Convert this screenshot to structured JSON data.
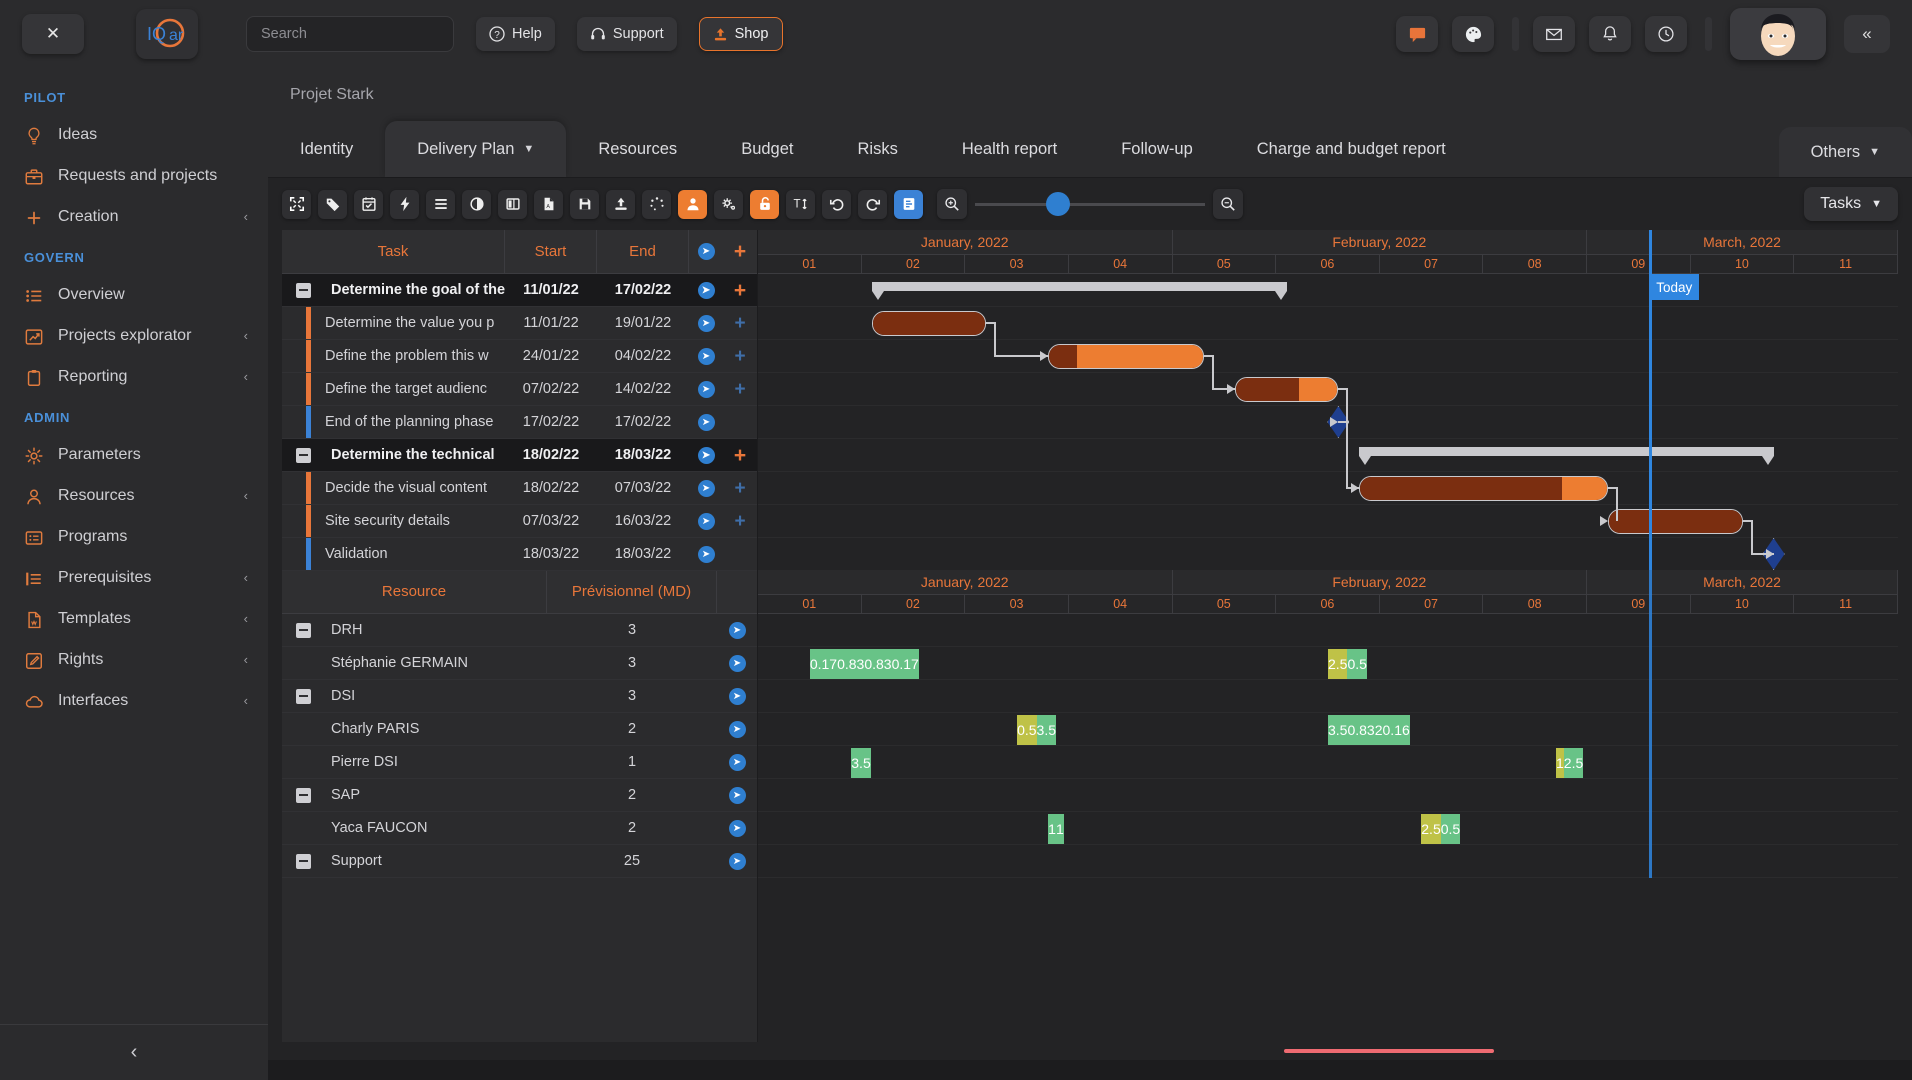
{
  "topbar": {
    "close_label": "✕",
    "logo_text": "IQar",
    "search_placeholder": "Search",
    "help_label": "Help",
    "support_label": "Support",
    "shop_label": "Shop",
    "icons": [
      "chat-icon",
      "palette-icon",
      "mail-icon",
      "bell-icon",
      "clock-icon"
    ],
    "collapse_label": "«"
  },
  "sidebar": {
    "sections": [
      {
        "title": "PILOT",
        "items": [
          {
            "label": "Ideas",
            "icon": "lightbulb-icon",
            "caret": false
          },
          {
            "label": "Requests and projects",
            "icon": "briefcase-icon",
            "caret": false
          },
          {
            "label": "Creation",
            "icon": "plus-icon",
            "caret": true
          }
        ]
      },
      {
        "title": "GOVERN",
        "items": [
          {
            "label": "Overview",
            "icon": "list-icon",
            "caret": false
          },
          {
            "label": "Projects explorator",
            "icon": "export-chart-icon",
            "caret": true
          },
          {
            "label": "Reporting",
            "icon": "clipboard-icon",
            "caret": true
          }
        ]
      },
      {
        "title": "ADMIN",
        "items": [
          {
            "label": "Parameters",
            "icon": "gear-icon",
            "caret": false
          },
          {
            "label": "Resources",
            "icon": "user-icon",
            "caret": true
          },
          {
            "label": "Programs",
            "icon": "grid-card-icon",
            "caret": false
          },
          {
            "label": "Prerequisites",
            "icon": "indent-list-icon",
            "caret": true
          },
          {
            "label": "Templates",
            "icon": "document-icon",
            "caret": true
          },
          {
            "label": "Rights",
            "icon": "edit-square-icon",
            "caret": true
          },
          {
            "label": "Interfaces",
            "icon": "cloud-icon",
            "caret": true
          }
        ]
      }
    ],
    "collapse_label": "‹"
  },
  "breadcrumb": {
    "text": "Projet Stark"
  },
  "tabs": {
    "items": [
      {
        "label": "Identity",
        "active": false,
        "caret": false
      },
      {
        "label": "Delivery Plan",
        "active": true,
        "caret": true
      },
      {
        "label": "Resources",
        "active": false,
        "caret": false
      },
      {
        "label": "Budget",
        "active": false,
        "caret": false
      },
      {
        "label": "Risks",
        "active": false,
        "caret": false
      },
      {
        "label": "Health report",
        "active": false,
        "caret": false
      },
      {
        "label": "Follow-up",
        "active": false,
        "caret": false
      },
      {
        "label": "Charge and budget report",
        "active": false,
        "caret": false
      }
    ],
    "others": {
      "label": "Others",
      "caret": true
    }
  },
  "toolbar": {
    "buttons": [
      {
        "name": "fit-screen-icon",
        "state": "normal"
      },
      {
        "name": "tag-icon",
        "state": "normal"
      },
      {
        "name": "calendar-check-icon",
        "state": "normal"
      },
      {
        "name": "lightning-icon",
        "state": "normal"
      },
      {
        "name": "menu-lines-icon",
        "state": "normal"
      },
      {
        "name": "contrast-circle-icon",
        "state": "normal"
      },
      {
        "name": "columns-icon",
        "state": "normal"
      },
      {
        "name": "pdf-file-icon",
        "state": "normal"
      },
      {
        "name": "save-disk-icon",
        "state": "normal"
      },
      {
        "name": "upload-icon",
        "state": "normal"
      },
      {
        "name": "spinner-dots-icon",
        "state": "normal"
      },
      {
        "name": "person-icon",
        "state": "orange"
      },
      {
        "name": "gears-icon",
        "state": "normal"
      },
      {
        "name": "unlock-icon",
        "state": "orange"
      },
      {
        "name": "text-height-icon",
        "state": "normal"
      },
      {
        "name": "undo-icon",
        "state": "normal"
      },
      {
        "name": "redo-icon",
        "state": "normal"
      },
      {
        "name": "report-icon",
        "state": "blue"
      }
    ],
    "zoom_in_icon": "zoom-in-icon",
    "zoom_out_icon": "zoom-out-icon",
    "zoom_value": 36,
    "tasks_dropdown": "Tasks"
  },
  "task_table": {
    "headers": {
      "task": "Task",
      "start": "Start",
      "end": "End"
    },
    "rows": [
      {
        "type": "summary",
        "name": "Determine the goal of the",
        "start": "11/01/22",
        "end": "17/02/22",
        "has_plus": true
      },
      {
        "type": "task",
        "marker": "orange",
        "name": "Determine the value you p",
        "start": "11/01/22",
        "end": "19/01/22",
        "has_plus": true,
        "plus_dim": true
      },
      {
        "type": "task",
        "marker": "orange",
        "name": "Define the problem this w",
        "start": "24/01/22",
        "end": "04/02/22",
        "has_plus": true,
        "plus_dim": true
      },
      {
        "type": "task",
        "marker": "orange",
        "name": "Define the target audienc",
        "start": "07/02/22",
        "end": "14/02/22",
        "has_plus": true,
        "plus_dim": true
      },
      {
        "type": "task",
        "marker": "blue",
        "name": "End of the planning phase",
        "start": "17/02/22",
        "end": "17/02/22",
        "has_plus": false
      },
      {
        "type": "summary",
        "name": "Determine the technical",
        "start": "18/02/22",
        "end": "18/03/22",
        "has_plus": true
      },
      {
        "type": "task",
        "marker": "orange",
        "name": "Decide the visual content",
        "start": "18/02/22",
        "end": "07/03/22",
        "has_plus": true,
        "plus_dim": true
      },
      {
        "type": "task",
        "marker": "orange",
        "name": "Site security details",
        "start": "07/03/22",
        "end": "16/03/22",
        "has_plus": true,
        "plus_dim": true
      },
      {
        "type": "task",
        "marker": "blue",
        "name": "Validation",
        "start": "18/03/22",
        "end": "18/03/22",
        "has_plus": false
      }
    ]
  },
  "resource_table": {
    "headers": {
      "resource": "Resource",
      "planned": "Prévisionnel (MD)"
    },
    "rows": [
      {
        "type": "group",
        "name": "DRH",
        "value": "3"
      },
      {
        "type": "member",
        "name": "Stéphanie GERMAIN",
        "value": "3"
      },
      {
        "type": "group",
        "name": "DSI",
        "value": "3"
      },
      {
        "type": "member",
        "name": "Charly PARIS",
        "value": "2"
      },
      {
        "type": "member",
        "name": "Pierre DSI",
        "value": "1"
      },
      {
        "type": "group",
        "name": "SAP",
        "value": "2"
      },
      {
        "type": "member",
        "name": "Yaca FAUCON",
        "value": "2"
      },
      {
        "type": "group",
        "name": "Support",
        "value": "25"
      }
    ]
  },
  "timeline": {
    "months": [
      {
        "label": "January, 2022",
        "weeks": 4
      },
      {
        "label": "February, 2022",
        "weeks": 4
      },
      {
        "label": "March, 2022",
        "weeks": 3
      }
    ],
    "weeks": [
      "01",
      "02",
      "03",
      "04",
      "05",
      "06",
      "07",
      "08",
      "09",
      "10",
      "11"
    ],
    "today_label": "Today"
  },
  "chart_data": {
    "type": "gantt",
    "title": "Delivery Plan — Projet Stark",
    "time_axis": {
      "unit": "week",
      "ticks": [
        "01",
        "02",
        "03",
        "04",
        "05",
        "06",
        "07",
        "08",
        "09",
        "10",
        "11"
      ],
      "months": [
        "January, 2022",
        "February, 2022",
        "March, 2022"
      ],
      "today_marker_week": 8.6
    },
    "tasks": [
      {
        "name": "Determine the goal of the",
        "start": "11/01/22",
        "end": "17/02/22",
        "kind": "summary",
        "start_week": 1.1,
        "end_week": 5.1
      },
      {
        "name": "Determine the value you p",
        "start": "11/01/22",
        "end": "19/01/22",
        "kind": "task",
        "progress_pct": 100,
        "start_week": 1.1,
        "end_week": 2.2
      },
      {
        "name": "Define the problem this w",
        "start": "24/01/22",
        "end": "04/02/22",
        "kind": "task",
        "progress_pct": 18,
        "start_week": 2.8,
        "end_week": 4.3
      },
      {
        "name": "Define the target audienc",
        "start": "07/02/22",
        "end": "14/02/22",
        "kind": "task",
        "progress_pct": 62,
        "start_week": 4.6,
        "end_week": 5.6
      },
      {
        "name": "End of the planning phase",
        "start": "17/02/22",
        "end": "17/02/22",
        "kind": "milestone",
        "start_week": 5.6,
        "end_week": 5.6
      },
      {
        "name": "Determine the technical",
        "start": "18/02/22",
        "end": "18/03/22",
        "kind": "summary",
        "start_week": 5.8,
        "end_week": 9.8
      },
      {
        "name": "Decide the visual content",
        "start": "18/02/22",
        "end": "07/03/22",
        "kind": "task",
        "progress_pct": 82,
        "start_week": 5.8,
        "end_week": 8.2
      },
      {
        "name": "Site security details",
        "start": "07/03/22",
        "end": "16/03/22",
        "kind": "task",
        "progress_pct": 100,
        "start_week": 8.2,
        "end_week": 9.5
      },
      {
        "name": "Validation",
        "start": "18/03/22",
        "end": "18/03/22",
        "kind": "milestone",
        "start_week": 9.8,
        "end_week": 9.8
      }
    ],
    "resource_histogram": {
      "unit": "MD",
      "green_color": "#68c387",
      "olive_color": "#bfc247",
      "rows": [
        {
          "resource": "DRH",
          "segments": []
        },
        {
          "resource": "Stéphanie GERMAIN",
          "segments": [
            {
              "value": "0.17",
              "level": "green",
              "start_week": 0.5,
              "weeks": 1
            },
            {
              "value": "0.83",
              "level": "green",
              "start_week": 1.5,
              "weeks": 1
            },
            {
              "value": "0.83",
              "level": "green",
              "start_week": 2.5,
              "weeks": 1
            },
            {
              "value": "0.17",
              "level": "green",
              "start_week": 3.5,
              "weeks": 1
            },
            {
              "value": "2.5",
              "level": "olive",
              "start_week": 5.5,
              "weeks": 1
            },
            {
              "value": "0.5",
              "level": "green",
              "start_week": 6.5,
              "weeks": 1
            }
          ]
        },
        {
          "resource": "DSI",
          "segments": []
        },
        {
          "resource": "Charly PARIS",
          "segments": [
            {
              "value": "0.5",
              "level": "olive",
              "start_week": 2.5,
              "weeks": 1
            },
            {
              "value": "3.5",
              "level": "green",
              "start_week": 3.5,
              "weeks": 1
            },
            {
              "value": "3.5",
              "level": "green",
              "start_week": 5.5,
              "weeks": 1
            },
            {
              "value": "0.83",
              "level": "green",
              "start_week": 6.5,
              "weeks": 1
            },
            {
              "value": "2",
              "level": "green",
              "start_week": 7.5,
              "weeks": 1
            },
            {
              "value": "0.16",
              "level": "green",
              "start_week": 8.5,
              "weeks": 1
            }
          ]
        },
        {
          "resource": "Pierre DSI",
          "segments": [
            {
              "value": "3.5",
              "level": "green",
              "start_week": 0.9,
              "weeks": 1
            },
            {
              "value": "1",
              "level": "olive",
              "start_week": 7.7,
              "weeks": 1
            },
            {
              "value": "2.5",
              "level": "green",
              "start_week": 8.7,
              "weeks": 1
            }
          ]
        },
        {
          "resource": "SAP",
          "segments": []
        },
        {
          "resource": "Yaca FAUCON",
          "segments": [
            {
              "value": "1",
              "level": "green",
              "start_week": 2.8,
              "weeks": 1
            },
            {
              "value": "1",
              "level": "green",
              "start_week": 3.8,
              "weeks": 1
            },
            {
              "value": "2.5",
              "level": "olive",
              "start_week": 6.4,
              "weeks": 1
            },
            {
              "value": "0.5",
              "level": "green",
              "start_week": 7.4,
              "weeks": 1
            }
          ]
        },
        {
          "resource": "Support",
          "segments": []
        }
      ]
    }
  },
  "colors": {
    "accent_orange": "#e8763a",
    "bar_done": "#7b2e10",
    "bar_rest": "#ed7d31",
    "today_blue": "#2f86e0",
    "milestone_blue": "#1f3f8f",
    "section_blue": "#4a90d9",
    "panel_bg": "#2b2b2d",
    "app_bg": "#232325"
  }
}
